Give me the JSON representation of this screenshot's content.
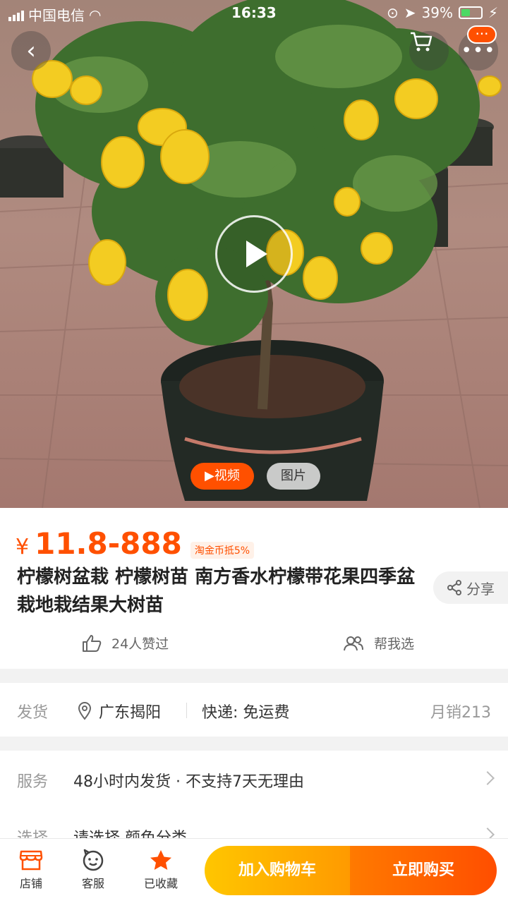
{
  "status_bar": {
    "carrier": "中国电信",
    "time": "16:33",
    "battery": "39%"
  },
  "media": {
    "tabs": [
      {
        "label": "▶视频",
        "active": true
      },
      {
        "label": "图片",
        "active": false
      }
    ]
  },
  "header": {
    "more_badge": "···"
  },
  "product": {
    "currency": "¥",
    "price": "11.8-888",
    "coin_badge": "淘金币抵5%",
    "title": "柠檬树盆栽 柠檬树苗 南方香水柠檬带花果四季盆栽地栽结果大树苗",
    "share_label": "分享",
    "likes_label": "24人赞过",
    "help_label": "帮我选"
  },
  "shipping": {
    "label": "发货",
    "location": "广东揭阳",
    "express": "快递: 免运费",
    "monthly_sales": "月销213"
  },
  "service": {
    "label": "服务",
    "value": "48小时内发货 · 不支持7天无理由",
    "select_label": "选择",
    "select_value": "请选择 颜色分类"
  },
  "bottom_bar": {
    "store_label": "店铺",
    "service_label": "客服",
    "favorite_label": "已收藏",
    "add_cart_label": "加入购物车",
    "buy_now_label": "立即购买"
  },
  "colors": {
    "brand": "#ff5000",
    "cart_button": "#ffb300",
    "buy_button": "#ff5a00"
  }
}
